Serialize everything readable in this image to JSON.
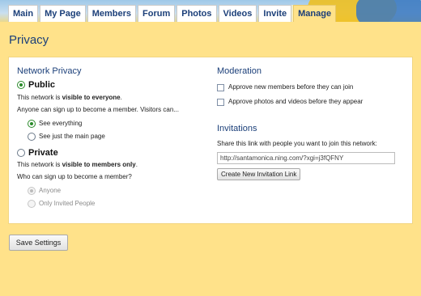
{
  "nav": {
    "tabs": [
      {
        "label": "Main"
      },
      {
        "label": "My Page"
      },
      {
        "label": "Members"
      },
      {
        "label": "Forum"
      },
      {
        "label": "Photos"
      },
      {
        "label": "Videos"
      },
      {
        "label": "Invite"
      },
      {
        "label": "Manage"
      }
    ]
  },
  "page": {
    "title": "Privacy"
  },
  "network_privacy": {
    "heading": "Network Privacy",
    "public": {
      "label": "Public",
      "desc_pre": "This network is ",
      "desc_bold": "visible to everyone",
      "desc_post": ".",
      "signup": "Anyone can sign up to become a member. Visitors can...",
      "options": [
        {
          "label": "See everything"
        },
        {
          "label": "See just the main page"
        }
      ]
    },
    "private": {
      "label": "Private",
      "desc_pre": "This network is ",
      "desc_bold": "visible to members only",
      "desc_post": ".",
      "question": "Who can sign up to become a member?",
      "options": [
        {
          "label": "Anyone"
        },
        {
          "label": "Only Invited People"
        }
      ]
    }
  },
  "moderation": {
    "heading": "Moderation",
    "options": [
      {
        "label": "Approve new members before they can join"
      },
      {
        "label": "Approve photos and videos before they appear"
      }
    ]
  },
  "invitations": {
    "heading": "Invitations",
    "desc": "Share this link with people you want to join this network:",
    "link": "http://santamonica.ning.com/?xgi=j3fQFNY",
    "button": "Create New Invitation Link"
  },
  "save_button": "Save Settings"
}
